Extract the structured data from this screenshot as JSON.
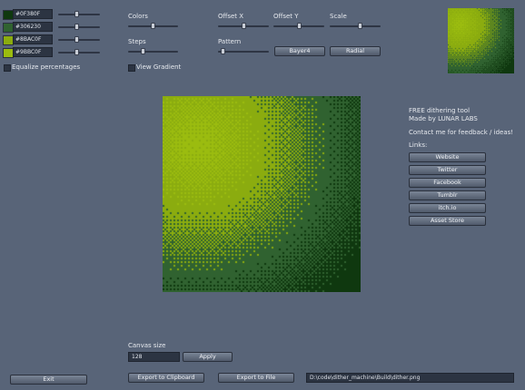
{
  "colors": [
    {
      "hex": "#0F380F",
      "slider": 0.45
    },
    {
      "hex": "#306230",
      "slider": 0.45
    },
    {
      "hex": "#8BAC0F",
      "slider": 0.45
    },
    {
      "hex": "#9BBC0F",
      "slider": 0.45
    }
  ],
  "equalize_label": "Equalize percentages",
  "view_gradient_label": "View Gradient",
  "controls": {
    "colors_label": "Colors",
    "steps_label": "Steps",
    "offset_x_label": "Offset X",
    "offset_y_label": "Offset Y",
    "scale_label": "Scale",
    "pattern_label": "Pattern",
    "pattern_options": [
      "Bayer4",
      "Radial"
    ],
    "colors_value": 0.5,
    "steps_value": 0.3,
    "offset_x_value": 0.5,
    "offset_y_value": 0.5,
    "scale_value": 0.6,
    "pattern_value": 0.1
  },
  "info": {
    "line1": "FREE dithering tool",
    "line2": "Made by LUNAR LABS",
    "contact": "Contact me for feedback / ideas!",
    "links_label": "Links:",
    "links": [
      "Website",
      "Twitter",
      "Facebook",
      "Tumblr",
      "itch.io",
      "Asset Store"
    ]
  },
  "canvas_size": {
    "label": "Canvas size",
    "value": "128",
    "apply_label": "Apply"
  },
  "footer": {
    "exit_label": "Exit",
    "export_clipboard_label": "Export to Clipboard",
    "export_file_label": "Export to File",
    "file_path": "D:\\code\\dither_machine\\Build\\dither.png"
  },
  "palette_colors": {
    "c0": "#0F380F",
    "c1": "#306230",
    "c2": "#8BAC0F",
    "c3": "#9BBC0F",
    "background": "#586478"
  }
}
